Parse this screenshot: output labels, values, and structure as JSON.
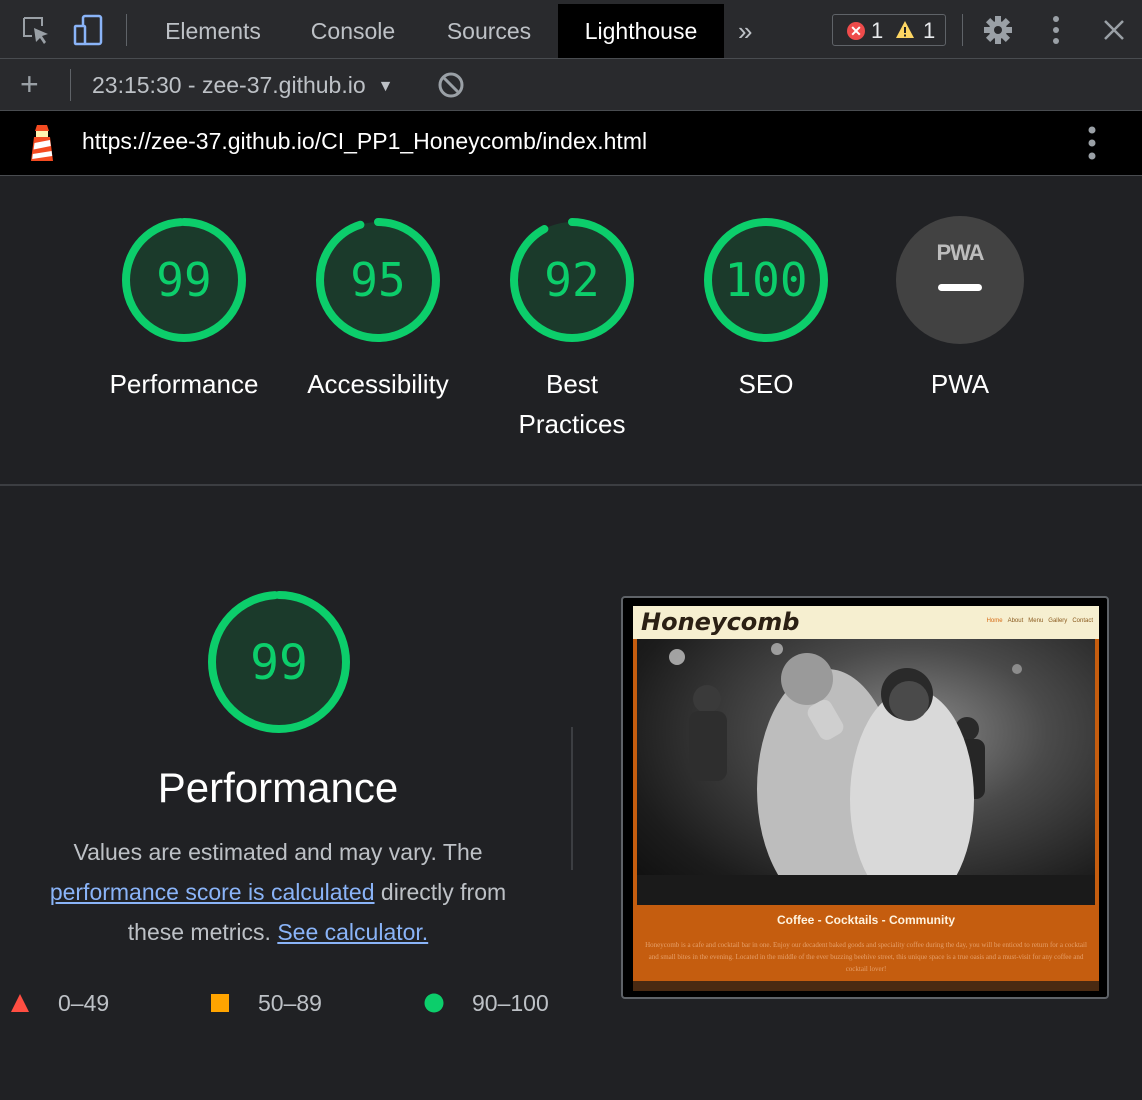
{
  "devtools": {
    "tabs": [
      {
        "label": "Elements",
        "active": false
      },
      {
        "label": "Console",
        "active": false
      },
      {
        "label": "Sources",
        "active": false
      },
      {
        "label": "Lighthouse",
        "active": true
      }
    ],
    "more_tabs": "»",
    "error_count": "1",
    "warning_count": "1",
    "error_glyph": "✕"
  },
  "toolbar": {
    "add_label": "+",
    "report_select": "23:15:30 - zee-37.github.io",
    "report_select_arrow": "▼"
  },
  "urlbar": {
    "url": "https://zee-37.github.io/CI_PP1_Honeycomb/index.html"
  },
  "gauges": [
    {
      "score": "99",
      "label": "Performance",
      "value": 0.99
    },
    {
      "score": "95",
      "label": "Accessibility",
      "value": 0.95
    },
    {
      "score": "92",
      "label": "Best Practices",
      "value": 0.92
    },
    {
      "score": "100",
      "label": "SEO",
      "value": 1.0
    }
  ],
  "pwa": {
    "label": "PWA",
    "badge_text": "PWA"
  },
  "performance": {
    "score": "99",
    "value": 0.99,
    "title": "Performance",
    "desc_1": "Values are estimated and may vary. The ",
    "link_1": "performance score is calculated",
    "desc_2": " directly from these metrics. ",
    "link_2": "See calculator."
  },
  "legend": [
    {
      "range": "0–49",
      "color": "#ff4e42",
      "shape": "triangle"
    },
    {
      "range": "50–89",
      "color": "#ffa400",
      "shape": "square"
    },
    {
      "range": "90–100",
      "color": "#0cce6b",
      "shape": "circle"
    }
  ],
  "thumbnail": {
    "brand": "Honeycomb",
    "nav": [
      "Home",
      "About",
      "Menu",
      "Gallery",
      "Contact"
    ],
    "tagline": "Coffee - Cocktails - Community",
    "paragraph": "Honeycomb is a cafe and cocktail bar in one. Enjoy our decadent baked goods and speciality coffee during the day, you will be enticed to return for a cocktail and small bites in the evening. Located in the middle of the ever buzzing beehive street, this unique space is a true oasis and a must-visit for any coffee and cocktail lover!"
  },
  "colors": {
    "pass": "#0cce6b",
    "pass_bg": "#1b3a2b",
    "average": "#ffa400",
    "fail": "#ff4e42",
    "link": "#8ab4f8",
    "pwa_bg": "#424242"
  },
  "icons": [
    "inspect-icon",
    "device-toolbar-icon",
    "settings-gear-icon",
    "more-vert-icon",
    "close-icon",
    "clear-block-icon",
    "lighthouse-logo-icon"
  ]
}
